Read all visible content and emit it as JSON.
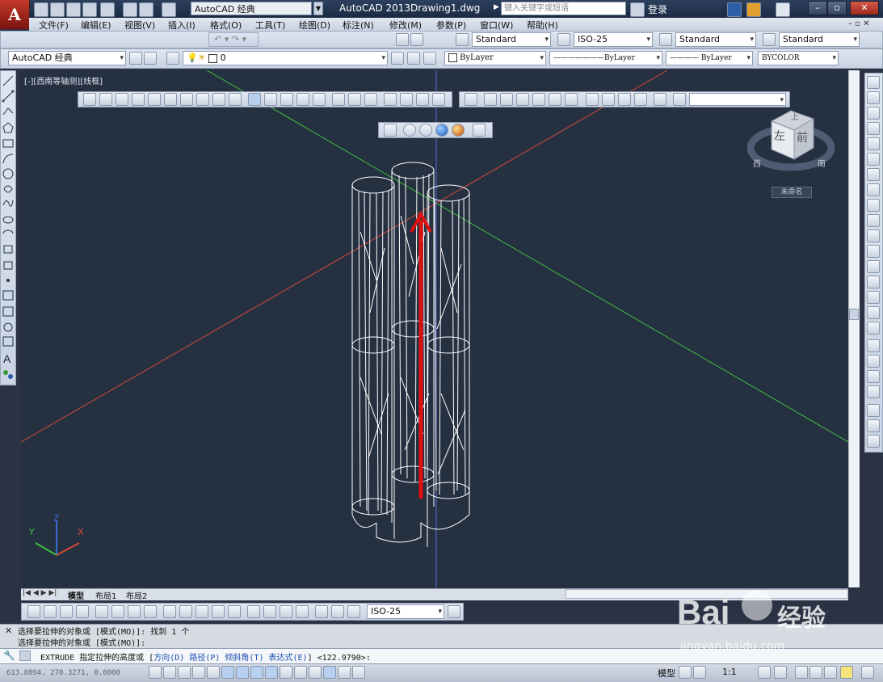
{
  "titlebar": {
    "app_logo": "A",
    "workspace": "AutoCAD 经典",
    "app_name": "AutoCAD 2013",
    "document": "Drawing1.dwg",
    "search_placeholder": "键入关键字或短语",
    "login": "登录"
  },
  "menu": [
    "文件(F)",
    "编辑(E)",
    "视图(V)",
    "插入(I)",
    "格式(O)",
    "工具(T)",
    "绘图(D)",
    "标注(N)",
    "修改(M)",
    "参数(P)",
    "窗口(W)",
    "帮助(H)"
  ],
  "styles_toolbar": {
    "text_style": "Standard",
    "dim_style": "ISO-25",
    "table_style": "Standard",
    "mleader_style": "Standard"
  },
  "layers_toolbar": {
    "workspace_combo": "AutoCAD 经典",
    "layer": "0"
  },
  "properties_toolbar": {
    "color": "ByLayer",
    "linetype": "ByLayer",
    "lineweight": "ByLayer",
    "plotstyle": "BYCOLOR"
  },
  "viewport": {
    "label": "[-][西南等轴测][线框]",
    "background": "#253041",
    "viewcube": {
      "top": "上",
      "left": "左",
      "front": "前",
      "west": "西",
      "south": "南"
    },
    "ucs_name": "未命名",
    "axis_labels": {
      "x": "X",
      "y": "Y",
      "z": "Z"
    },
    "x_axis_color": "#d44a3a",
    "y_axis_color": "#3fbf3f",
    "z_axis_color": "#3a6bd9",
    "arrow_color": "#e01010"
  },
  "layout_tabs": [
    "模型",
    "布局1",
    "布局2"
  ],
  "dim_toolbar": {
    "dim_style": "ISO-25"
  },
  "command_history": [
    "选择要拉伸的对象或 [模式(MO)]: 找到 1 个",
    "选择要拉伸的对象或 [模式(MO)]:"
  ],
  "command_line": {
    "command": "EXTRUDE",
    "prompt": "指定拉伸的高度或",
    "options": [
      "方向(D)",
      "路径(P)",
      "倾斜角(T)",
      "表达式(E)"
    ],
    "default": "<122.9790>:"
  },
  "statusbar": {
    "coords": "613.0894, 270.3271, 0.0000",
    "model": "模型",
    "scale": "1:1"
  },
  "watermark": {
    "brand": "Bai",
    "brand2": "经验",
    "url": "jingyan.baidu.com"
  }
}
